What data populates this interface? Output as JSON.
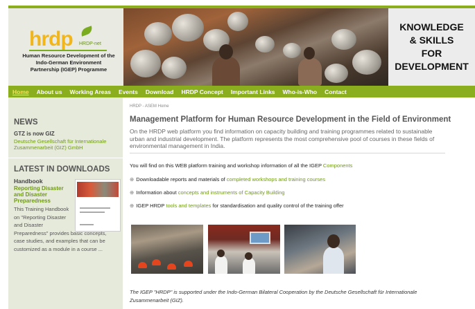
{
  "header": {
    "logo_text": "hrdp",
    "logo_subtext": "HRDP-net",
    "org_name": "Human Resource Development of the Indo-German Environment Partnership (IGEP) Programme",
    "tagline_lines": [
      "KNOWLEDGE",
      "& SKILLS",
      "FOR",
      "DEVELOPMENT"
    ]
  },
  "nav": {
    "items": [
      "Home",
      "About us",
      "Working Areas",
      "Events",
      "Download",
      "HRDP Concept",
      "Important Links",
      "Who-is-Who",
      "Contact"
    ],
    "active": "Home"
  },
  "sidebar": {
    "news_heading": "NEWS",
    "news_title": "GTZ is now GIZ",
    "news_link": "Deutsche Gesellschaft für Internationale Zusammenarbeit (GIZ) GmbH",
    "downloads_heading": "LATEST IN DOWNLOADS",
    "dl_title": "Handbook",
    "dl_link": "Reporting Disaster and Disaster Preparedness",
    "dl_desc_narrow": "This Training Handbook on \"Reporting Disaster and Disaster",
    "dl_desc_wide": "Preparedness\" provides basic concepts, case studies, and examples that can be customized as a module in a course ..."
  },
  "main": {
    "breadcrumb": "HRDP - ASEM Home",
    "title": "Management Platform for Human Resource Development in the Field of Environment",
    "intro": "On the HRDP web platform you find information on capacity building and training programmes related to sustainable urban and industrial development. The platform represents the most comprehensive pool of courses in these fields of environmental management in India.",
    "find_prefix": "You will find on this WEB platform training and workshop information of all the IGEP",
    "find_link": "Components",
    "bullets": [
      {
        "prefix": "Downloadable reports and materials of",
        "link": "completed workshops and training courses",
        "suffix": ""
      },
      {
        "prefix": "Information about",
        "link": "concepts and instruments of Capacity Building",
        "suffix": ""
      },
      {
        "prefix": "IGEP HRDP",
        "link": "tools and templates",
        "suffix": "for standardisation and quality control of the training offer"
      }
    ],
    "footer_note": "The IGEP \"HRDP\" is supported under the Indo-German Bilateral Cooperation by the Deutsche Gesellschaft für Internationale Zusammenarbeit (GIZ)."
  },
  "colors": {
    "accent_green": "#8aae1d",
    "link_green": "#6f9a12",
    "sidebar_bg": "#e6eadb"
  }
}
